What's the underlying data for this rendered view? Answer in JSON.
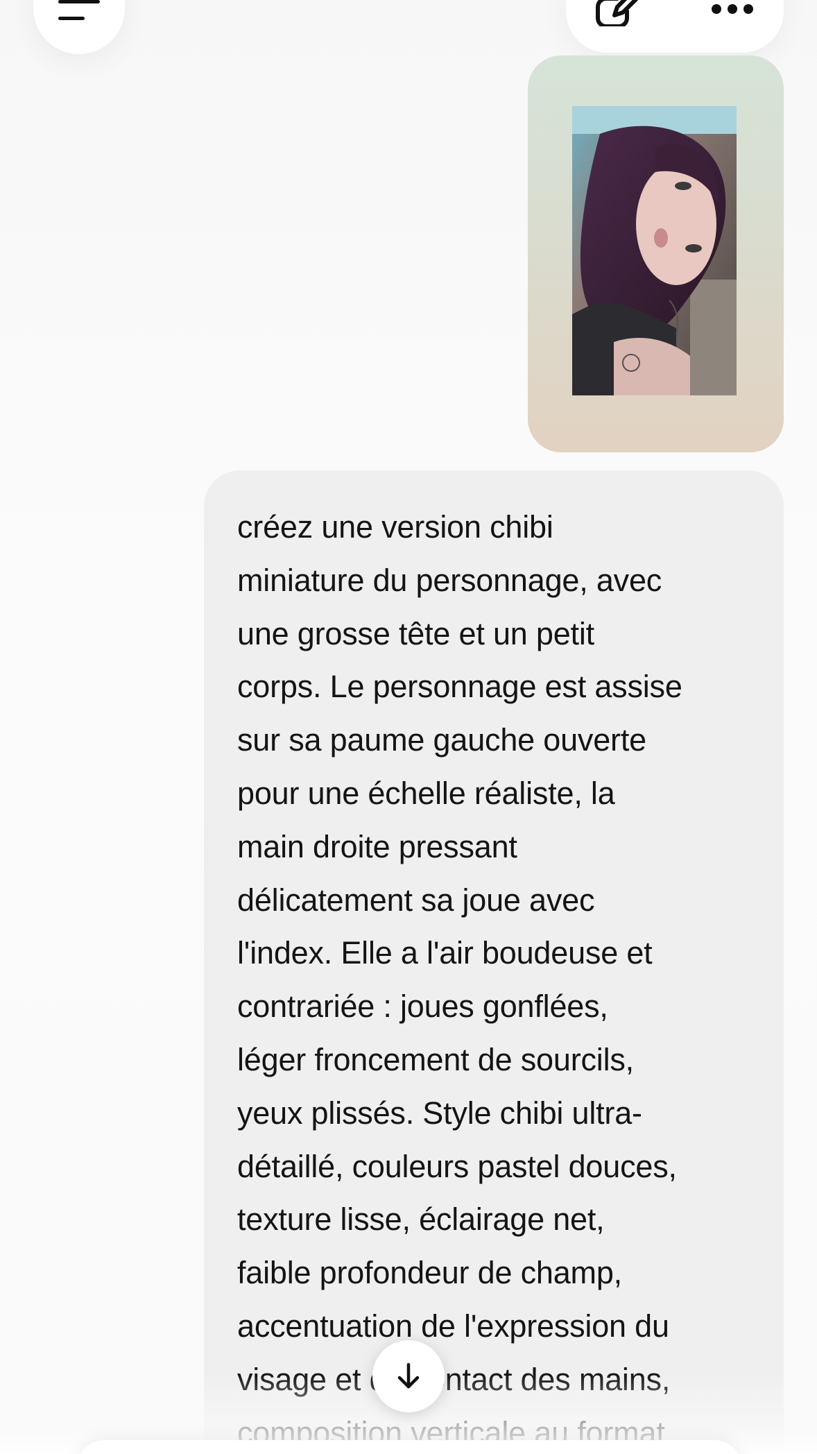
{
  "header": {
    "menu_icon": "menu-icon",
    "edit_icon": "new-chat-edit-icon",
    "more_icon": "more-options-icon"
  },
  "conversation": {
    "attached_image": {
      "kind": "photo",
      "description_icon": "attached-photo"
    },
    "user_message": "créez une version chibi\nminiature du personnage, avec\nune grosse tête et un petit\ncorps. Le personnage est assise\nsur sa paume gauche ouverte\npour une échelle réaliste, la\nmain droite pressant\ndélicatement sa joue avec\nl'index. Elle a l'air boudeuse et\ncontrariée : joues gonflées,\nléger froncement de sourcils,\nyeux plissés. Style chibi ultra-\ndétaillé, couleurs pastel douces,\ntexture lisse, éclairage net,\nfaible profondeur de champ,\naccentuation de l'expression du\nvisage et du contact des mains,\ncomposition verticale au format"
  },
  "scroll_button": {
    "icon": "arrow-down-icon"
  },
  "colors": {
    "background": "#fafafa",
    "bubble": "#efefef",
    "text": "#141414",
    "image_bubble_top": "#d5e4d7",
    "image_bubble_bottom": "#e2d2c1"
  }
}
